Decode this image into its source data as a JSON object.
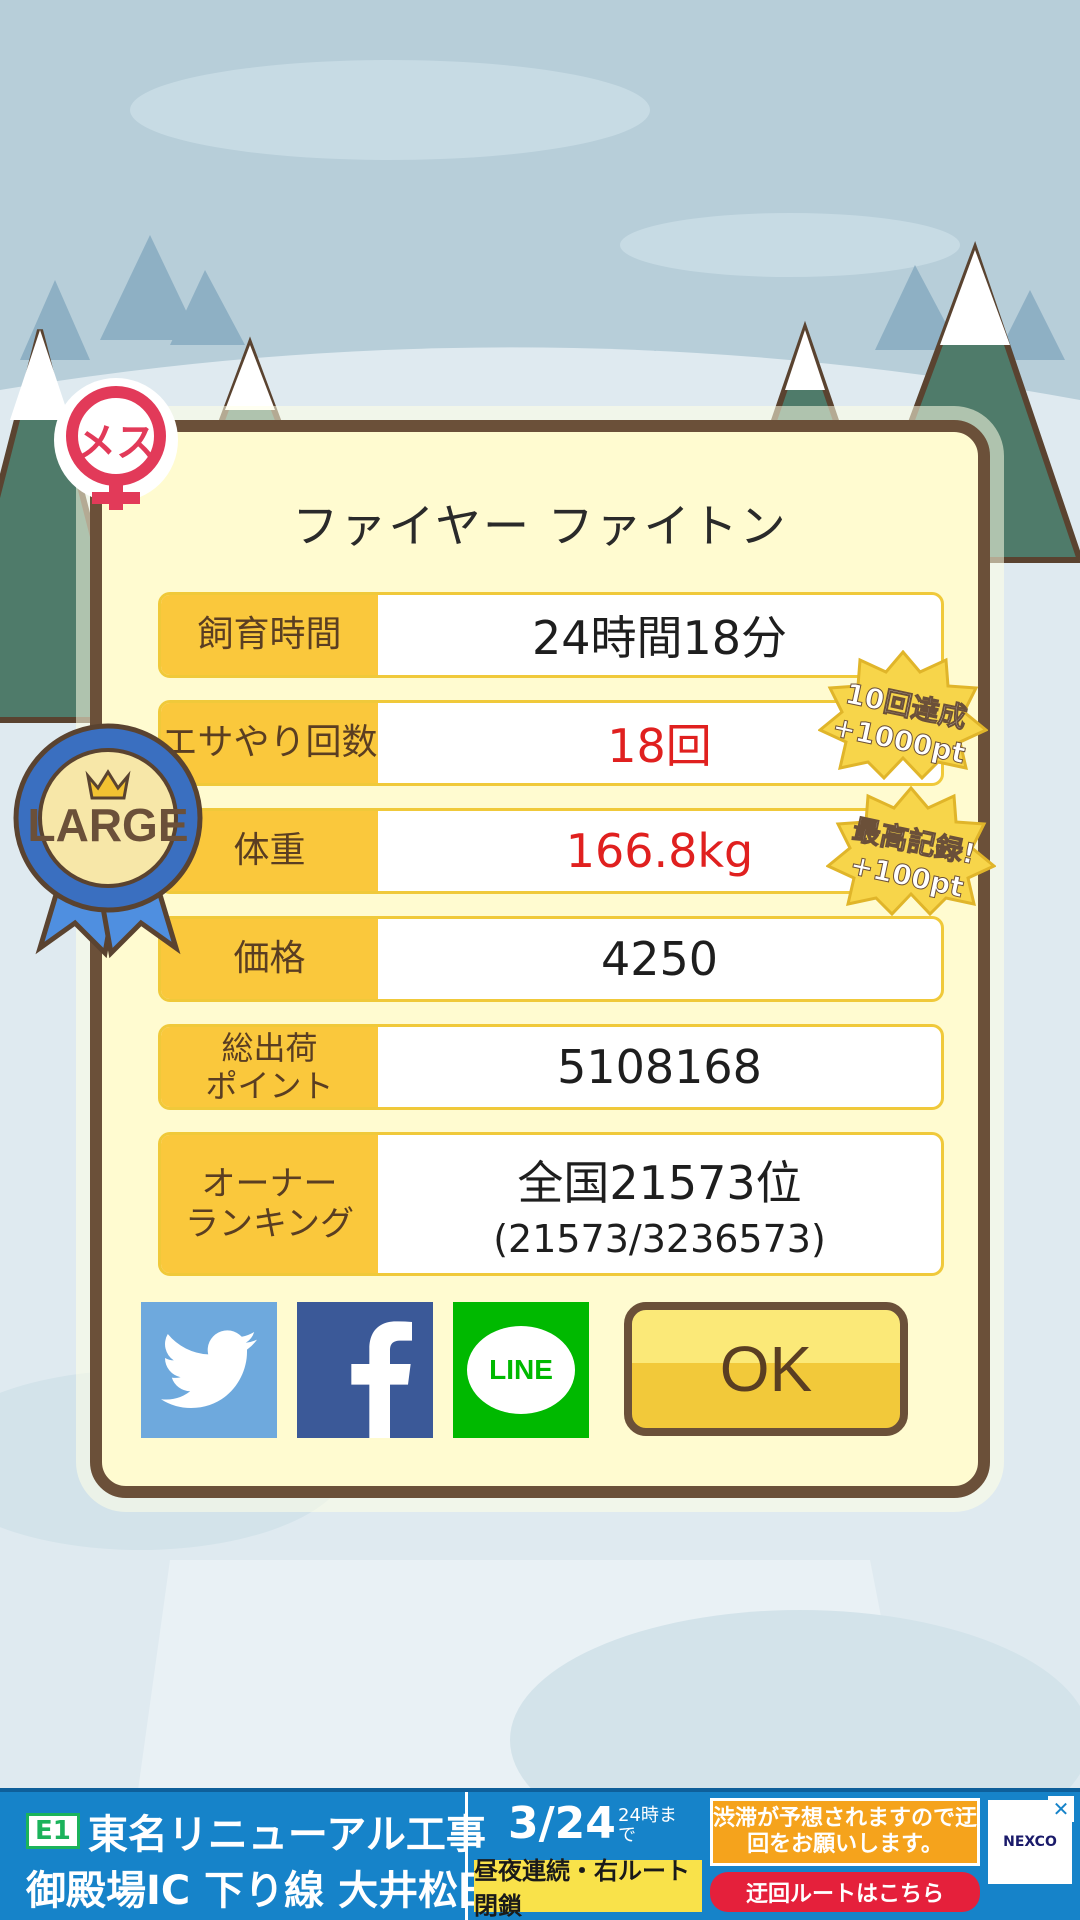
{
  "gender_badge": "メス",
  "size_badge": "LARGE",
  "pet_name": "ファイヤー ファイトン",
  "stats": [
    {
      "label": "飼育時間",
      "value": "24時間18分"
    },
    {
      "label": "エサやり回数",
      "value": "18回"
    },
    {
      "label": "体重",
      "value": "166.8kg"
    },
    {
      "label": "価格",
      "value": "4250"
    },
    {
      "label": "総出荷\nポイント",
      "value": "5108168"
    },
    {
      "label": "オーナー\nランキング",
      "value": "全国21573位",
      "sub": "(21573/3236573)"
    }
  ],
  "bonus_badges": [
    {
      "line1": "10回達成",
      "line2": "+1000pt"
    },
    {
      "line1": "最高記録!",
      "line2": "+100pt"
    }
  ],
  "social": {
    "twitter": "twitter-icon",
    "facebook": "facebook-icon",
    "line": "LINE"
  },
  "ok_label": "OK",
  "ad": {
    "road": "E1",
    "line1": "東名リニューアル工事",
    "line2": "御殿場IC 下り線 大井松田IC",
    "date": "3/24",
    "date_note": "24時まで",
    "closure": "昼夜連続・右ルート閉鎖",
    "warning": "渋滞が予想されますので迂回をお願いします。",
    "detour": "迂回ルートはこちら",
    "logo": "NEXCO",
    "close": "✕"
  },
  "colors": {
    "accent_label": "#fac83c",
    "border_brown": "#6b5039",
    "highlight_red": "#e0201f",
    "twitter": "#6ea9dd",
    "facebook": "#3b5998",
    "line": "#00b900"
  }
}
